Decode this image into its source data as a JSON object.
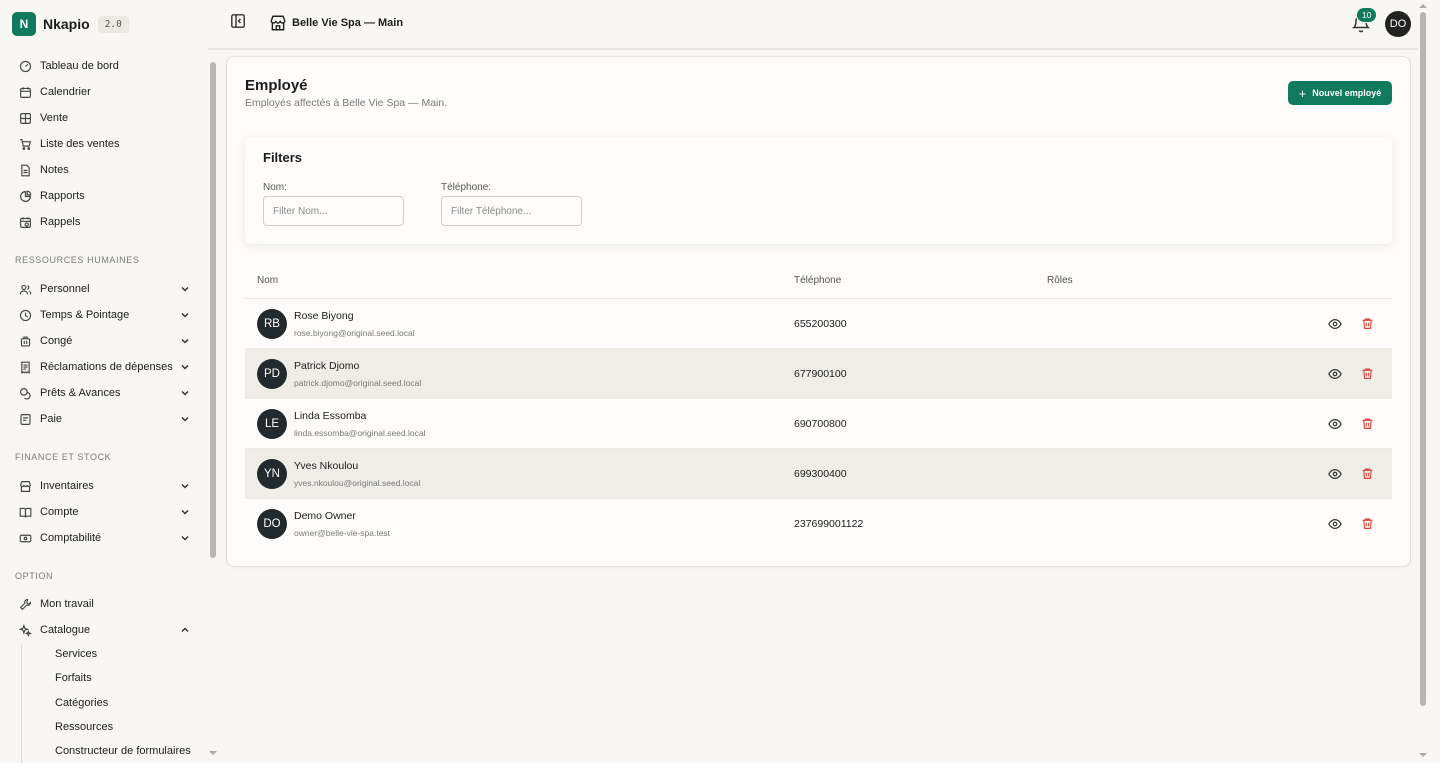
{
  "brand": {
    "name": "Nkapio",
    "version": "2.0"
  },
  "nav_main": [
    {
      "label": "Tableau de bord",
      "icon": "dashboard-icon"
    },
    {
      "label": "Calendrier",
      "icon": "calendar-icon"
    },
    {
      "label": "Vente",
      "icon": "grid-icon"
    },
    {
      "label": "Liste des ventes",
      "icon": "cart-icon"
    },
    {
      "label": "Notes",
      "icon": "note-icon"
    },
    {
      "label": "Rapports",
      "icon": "pie-icon"
    },
    {
      "label": "Rappels",
      "icon": "calendar-clock-icon"
    }
  ],
  "sections": {
    "hr": "RESSOURCES HUMAINES",
    "finance": "FINANCE ET STOCK",
    "option": "OPTION"
  },
  "nav_hr": [
    {
      "label": "Personnel",
      "icon": "users-icon"
    },
    {
      "label": "Temps & Pointage",
      "icon": "clock-icon"
    },
    {
      "label": "Congé",
      "icon": "luggage-icon"
    },
    {
      "label": "Réclamations de dépenses",
      "icon": "receipt-icon"
    },
    {
      "label": "Prêts & Avances",
      "icon": "coins-icon"
    },
    {
      "label": "Paie",
      "icon": "document-icon"
    }
  ],
  "nav_finance": [
    {
      "label": "Inventaires",
      "icon": "store-icon"
    },
    {
      "label": "Compte",
      "icon": "book-icon"
    },
    {
      "label": "Comptabilité",
      "icon": "banknote-icon"
    }
  ],
  "nav_option": [
    {
      "label": "Mon travail",
      "icon": "wrench-icon"
    },
    {
      "label": "Catalogue",
      "icon": "sparkles-icon"
    }
  ],
  "catalogue_sub": [
    "Services",
    "Forfaits",
    "Catégories",
    "Ressources",
    "Constructeur de formulaires"
  ],
  "topbar": {
    "store_name": "Belle Vie Spa — Main",
    "notifications": "10",
    "user_initials": "DO"
  },
  "page": {
    "title": "Employé",
    "subtitle": "Employés affectés à Belle Vie Spa — Main.",
    "new_button": "Nouvel employé"
  },
  "filters": {
    "title": "Filters",
    "name_label": "Nom:",
    "name_placeholder": "Filter Nom...",
    "phone_label": "Téléphone:",
    "phone_placeholder": "Filter Téléphone..."
  },
  "table": {
    "headers": [
      "Nom",
      "Téléphone",
      "Rôles"
    ],
    "rows": [
      {
        "initials": "RB",
        "name": "Rose Biyong",
        "email": "rose.biyong@original.seed.local",
        "phone": "655200300"
      },
      {
        "initials": "PD",
        "name": "Patrick Djomo",
        "email": "patrick.djomo@original.seed.local",
        "phone": "677900100"
      },
      {
        "initials": "LE",
        "name": "Linda Essomba",
        "email": "linda.essomba@original.seed.local",
        "phone": "690700800"
      },
      {
        "initials": "YN",
        "name": "Yves Nkoulou",
        "email": "yves.nkoulou@original.seed.local",
        "phone": "699300400"
      },
      {
        "initials": "DO",
        "name": "Demo Owner",
        "email": "owner@belle-vie-spa.test",
        "phone": "237699001122"
      }
    ]
  },
  "colors": {
    "accent": "#0f7a5c",
    "danger": "#d9463c",
    "row_alt": "#efede8"
  }
}
